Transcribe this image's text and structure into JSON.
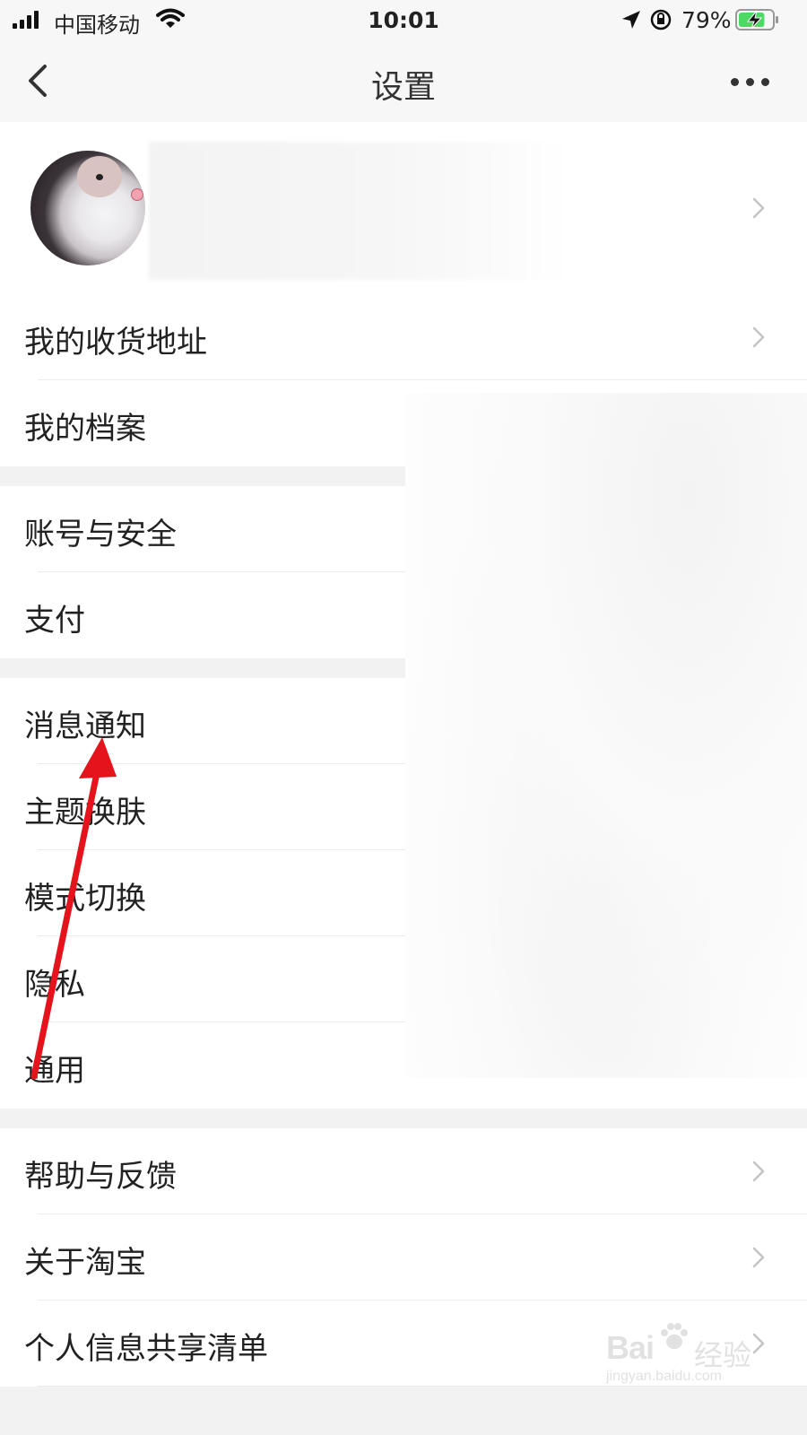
{
  "status_bar": {
    "carrier": "中国移动",
    "time": "10:01",
    "battery_percent": "79%",
    "battery_level": 0.79,
    "icons": [
      "signal-icon",
      "wifi-icon",
      "location-icon",
      "rotation-lock-icon",
      "battery-charging-icon"
    ]
  },
  "nav": {
    "title": "设置",
    "back_icon": "chevron-left-icon",
    "more_icon": "more-dots-icon"
  },
  "profile": {
    "avatar": "avatar"
  },
  "groups": [
    {
      "items": [
        {
          "label": "我的收货地址",
          "chevron": true
        },
        {
          "label": "我的档案",
          "chevron": false
        }
      ]
    },
    {
      "items": [
        {
          "label": "账号与安全",
          "chevron": false
        },
        {
          "label": "支付",
          "chevron": false
        }
      ]
    },
    {
      "items": [
        {
          "label": "消息通知",
          "chevron": false
        },
        {
          "label": "主题换肤",
          "chevron": false
        },
        {
          "label": "模式切换",
          "chevron": false
        },
        {
          "label": "隐私",
          "chevron": false
        },
        {
          "label": "通用",
          "chevron": false
        }
      ]
    },
    {
      "items": [
        {
          "label": "帮助与反馈",
          "chevron": true
        },
        {
          "label": "关于淘宝",
          "chevron": true
        },
        {
          "label": "个人信息共享清单",
          "chevron": true
        }
      ]
    }
  ],
  "annotation": {
    "arrow_color": "#e5131b"
  },
  "watermark": {
    "brand": "Bai",
    "brand_suffix": "经验",
    "url": "jingyan.baidu.com"
  },
  "colors": {
    "background": "#f2f2f2",
    "bar": "#f7f7f7",
    "row": "#ffffff",
    "text": "#222222",
    "chevron": "#c4c4c4"
  }
}
